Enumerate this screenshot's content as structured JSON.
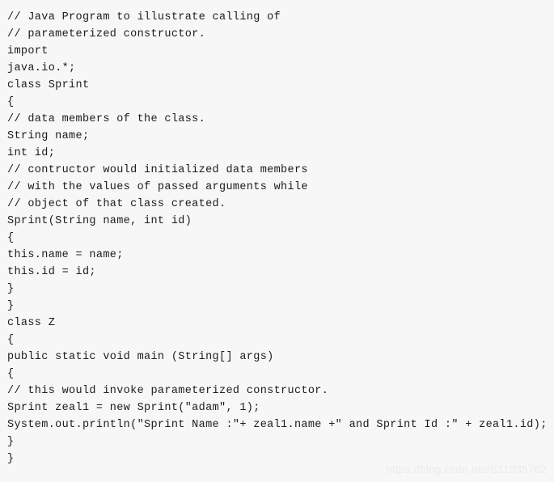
{
  "page": {
    "background_color": "#f7f7f7",
    "text_color": "#1c1c1c",
    "language": "java",
    "title": "Java parameterized constructor example"
  },
  "code": {
    "lines": [
      "// Java Program to illustrate calling of",
      "// parameterized constructor.",
      "import",
      "java.io.*;",
      "class Sprint",
      "{",
      "// data members of the class.",
      "String name;",
      "int id;",
      "// contructor would initialized data members",
      "// with the values of passed arguments while",
      "// object of that class created.",
      "Sprint(String name, int id)",
      "{",
      "this.name = name;",
      "this.id = id;",
      "}",
      "}",
      "class Z",
      "{",
      "public static void main (String[] args)",
      "{",
      "// this would invoke parameterized constructor.",
      "Sprint zeal1 = new Sprint(″adam″, 1);",
      "System.out.println(″Sprint Name :″+ zeal1.name +″ and Sprint Id :″ + zeal1.id);",
      "}",
      "}"
    ]
  },
  "watermark": {
    "text": "https://blog.csdn.net/S11035762",
    "color": "#ebebeb"
  }
}
